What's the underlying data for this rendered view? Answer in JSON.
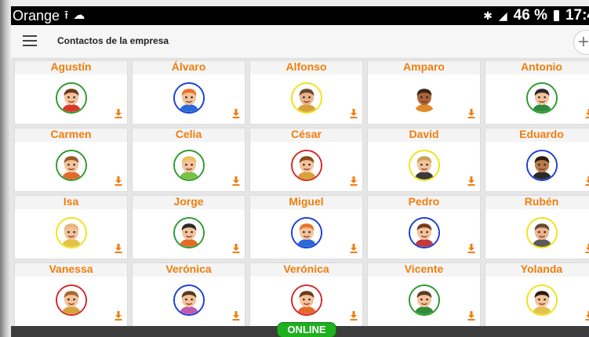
{
  "status_bar": {
    "carrier": "Orange",
    "battery": "46 %",
    "time": "17:4"
  },
  "app_bar": {
    "title": "Contactos de la empresa",
    "add_label": "+"
  },
  "contacts": [
    {
      "name": "Agustín",
      "ring": "#2e9b2e",
      "skin": "#f3c29a",
      "hair": "#6b3d1e",
      "shirt": "#d83a2a"
    },
    {
      "name": "Álvaro",
      "ring": "#1c3fd8",
      "skin": "#f3c29a",
      "hair": "#e8742a",
      "shirt": "#2b6ad8"
    },
    {
      "name": "Alfonso",
      "ring": "#f2e21a",
      "skin": "#e9b38b",
      "hair": "#6b4a2e",
      "shirt": "#d8a23a"
    },
    {
      "name": "Amparo",
      "ring": "",
      "skin": "#a8643a",
      "hair": "#3a2414",
      "shirt": "#e08a2a"
    },
    {
      "name": "Antonio",
      "ring": "#2e9b2e",
      "skin": "#f3c29a",
      "hair": "#2a2a2a",
      "shirt": "#2f8c3a"
    },
    {
      "name": "Carmen",
      "ring": "#2e9b2e",
      "skin": "#f3c29a",
      "hair": "#9a5a2a",
      "shirt": "#e36a2a"
    },
    {
      "name": "Celia",
      "ring": "#2e9b2e",
      "skin": "#f3c29a",
      "hair": "#e8c35a",
      "shirt": "#7ac04a"
    },
    {
      "name": "César",
      "ring": "#d62a2a",
      "skin": "#f3c29a",
      "hair": "#8a4a1e",
      "shirt": "#d8a23a"
    },
    {
      "name": "David",
      "ring": "#f2e21a",
      "skin": "#f3c29a",
      "hair": "#c9a25a",
      "shirt": "#3a3a3a"
    },
    {
      "name": "Eduardo",
      "ring": "#1c3fd8",
      "skin": "#b87a4a",
      "hair": "#2a1a10",
      "shirt": "#2a2a2a"
    },
    {
      "name": "Isa",
      "ring": "#f2e21a",
      "skin": "#f3c29a",
      "hair": "#e8b878",
      "shirt": "#e3c24a"
    },
    {
      "name": "Jorge",
      "ring": "#2e9b2e",
      "skin": "#f3c29a",
      "hair": "#2a2a2a",
      "shirt": "#e36a2a"
    },
    {
      "name": "Miguel",
      "ring": "#1c3fd8",
      "skin": "#f3c29a",
      "hair": "#e8742a",
      "shirt": "#2b6ad8"
    },
    {
      "name": "Pedro",
      "ring": "#1c3fd8",
      "skin": "#f3c29a",
      "hair": "#7a3a1a",
      "shirt": "#c43a3a"
    },
    {
      "name": "Rubén",
      "ring": "#f2e21a",
      "skin": "#e9b38b",
      "hair": "#6b4a2e",
      "shirt": "#5a5a5a"
    },
    {
      "name": "Vanessa",
      "ring": "#d62a2a",
      "skin": "#f3c29a",
      "hair": "#a66a2a",
      "shirt": "#d8a23a"
    },
    {
      "name": "Verónica",
      "ring": "#1c3fd8",
      "skin": "#f3c29a",
      "hair": "#5a3a1e",
      "shirt": "#c05ab0"
    },
    {
      "name": "Verónica",
      "ring": "#d62a2a",
      "skin": "#f3c29a",
      "hair": "#6b3a1a",
      "shirt": "#e36a2a"
    },
    {
      "name": "Vicente",
      "ring": "#2e9b2e",
      "skin": "#f3c29a",
      "hair": "#5a3a1e",
      "shirt": "#2f8c3a"
    },
    {
      "name": "Yolanda",
      "ring": "#f2e21a",
      "skin": "#f3c29a",
      "hair": "#2a1a10",
      "shirt": "#e3c24a"
    }
  ],
  "accent_color": "#f07e0c",
  "bottom_bar": {
    "status_label": "ONLINE",
    "status_color": "#1fb01f"
  }
}
